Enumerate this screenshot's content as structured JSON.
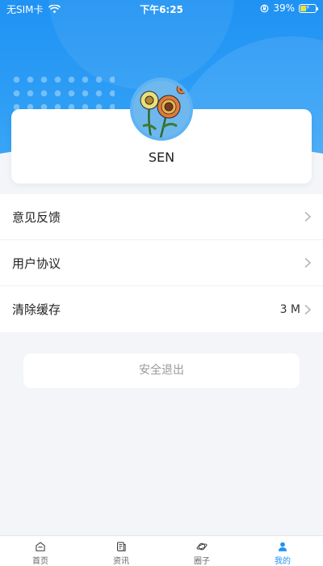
{
  "status_bar": {
    "carrier": "无SIM卡",
    "time": "下午6:25",
    "battery_percent": "39%",
    "battery_level": 0.39
  },
  "profile": {
    "username": "SEN"
  },
  "menu": {
    "items": [
      {
        "label": "意见反馈",
        "value": ""
      },
      {
        "label": "用户协议",
        "value": ""
      },
      {
        "label": "清除缓存",
        "value": "3 M"
      }
    ]
  },
  "logout": {
    "label": "安全退出"
  },
  "tabbar": {
    "items": [
      {
        "label": "首页",
        "icon": "home-icon",
        "active": false
      },
      {
        "label": "资讯",
        "icon": "news-icon",
        "active": false
      },
      {
        "label": "圈子",
        "icon": "planet-icon",
        "active": false
      },
      {
        "label": "我的",
        "icon": "user-icon",
        "active": true
      }
    ]
  },
  "colors": {
    "accent": "#1f92f3",
    "background": "#f3f5f9"
  }
}
